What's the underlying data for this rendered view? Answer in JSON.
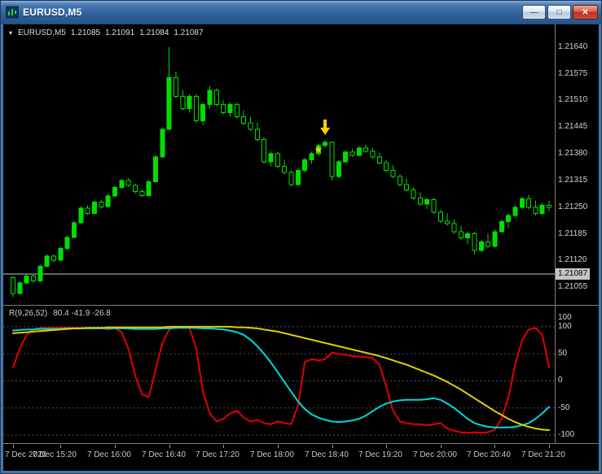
{
  "window": {
    "title": "EURUSD,M5",
    "icons": {
      "minimize": "—",
      "maximize": "□",
      "close": "✕",
      "dropdown": "▾",
      "star": "★"
    }
  },
  "colors": {
    "background": "#000000",
    "candle": "#00dd00",
    "bid_line": "#c8c8c8",
    "grid": "#4f4f4f",
    "marker": "#ffd000"
  },
  "chart_header": {
    "symbol": "EURUSD,M5",
    "open": "1.21085",
    "high": "1.21091",
    "low": "1.21084",
    "close": "1.21087"
  },
  "price_axis": {
    "labels": [
      1.2164,
      1.21575,
      1.2151,
      1.21445,
      1.2138,
      1.21315,
      1.2125,
      1.21185,
      1.2112,
      1.21055
    ],
    "current": 1.21087
  },
  "indicator": {
    "name": "R(9,26,52)",
    "values_text": "80.4 -41.9 -26.8"
  },
  "time_axis": {
    "labels": [
      {
        "t": "7 Dec 2020",
        "i": 0
      },
      {
        "t": "7 Dec 15:20",
        "i": 7
      },
      {
        "t": "7 Dec 16:00",
        "i": 15
      },
      {
        "t": "7 Dec 16:40",
        "i": 23
      },
      {
        "t": "7 Dec 17:20",
        "i": 31
      },
      {
        "t": "7 Dec 18:00",
        "i": 39
      },
      {
        "t": "7 Dec 18:40",
        "i": 47
      },
      {
        "t": "7 Dec 19:20",
        "i": 55
      },
      {
        "t": "7 Dec 20:00",
        "i": 63
      },
      {
        "t": "7 Dec 20:40",
        "i": 71
      },
      {
        "t": "7 Dec 21:20",
        "i": 79
      }
    ]
  },
  "chart_data": [
    {
      "type": "candlestick",
      "title": "EURUSD M5",
      "symbol": "EURUSD",
      "period": "M5",
      "ylim": [
        1.21012,
        1.21695
      ],
      "bid": 1.21087,
      "candles": [
        {
          "t": "14:45",
          "o": 1.21078,
          "h": 1.21082,
          "l": 1.21032,
          "c": 1.2104
        },
        {
          "t": "14:50",
          "o": 1.2104,
          "h": 1.21069,
          "l": 1.21038,
          "c": 1.21065
        },
        {
          "t": "14:55",
          "o": 1.21065,
          "h": 1.21086,
          "l": 1.21062,
          "c": 1.21082
        },
        {
          "t": "15:00",
          "o": 1.21082,
          "h": 1.21088,
          "l": 1.21066,
          "c": 1.2107
        },
        {
          "t": "15:05",
          "o": 1.2107,
          "h": 1.2111,
          "l": 1.21068,
          "c": 1.21106
        },
        {
          "t": "15:10",
          "o": 1.21106,
          "h": 1.21136,
          "l": 1.21103,
          "c": 1.21131
        },
        {
          "t": "15:15",
          "o": 1.21131,
          "h": 1.21135,
          "l": 1.21116,
          "c": 1.21121
        },
        {
          "t": "15:20",
          "o": 1.21121,
          "h": 1.21154,
          "l": 1.21119,
          "c": 1.2115
        },
        {
          "t": "15:25",
          "o": 1.2115,
          "h": 1.2118,
          "l": 1.21147,
          "c": 1.21176
        },
        {
          "t": "15:30",
          "o": 1.21176,
          "h": 1.21216,
          "l": 1.21174,
          "c": 1.21212
        },
        {
          "t": "15:35",
          "o": 1.21212,
          "h": 1.21252,
          "l": 1.2121,
          "c": 1.21248
        },
        {
          "t": "15:40",
          "o": 1.21248,
          "h": 1.21255,
          "l": 1.21231,
          "c": 1.21235
        },
        {
          "t": "15:45",
          "o": 1.21235,
          "h": 1.21266,
          "l": 1.21233,
          "c": 1.21262
        },
        {
          "t": "15:50",
          "o": 1.21262,
          "h": 1.21268,
          "l": 1.21247,
          "c": 1.21251
        },
        {
          "t": "15:55",
          "o": 1.21251,
          "h": 1.21281,
          "l": 1.21249,
          "c": 1.21277
        },
        {
          "t": "16:00",
          "o": 1.21277,
          "h": 1.21302,
          "l": 1.21274,
          "c": 1.21298
        },
        {
          "t": "16:05",
          "o": 1.21298,
          "h": 1.21319,
          "l": 1.21295,
          "c": 1.21315
        },
        {
          "t": "16:10",
          "o": 1.21315,
          "h": 1.2132,
          "l": 1.21299,
          "c": 1.21303
        },
        {
          "t": "16:15",
          "o": 1.21303,
          "h": 1.21307,
          "l": 1.21283,
          "c": 1.21288
        },
        {
          "t": "16:20",
          "o": 1.21288,
          "h": 1.21293,
          "l": 1.21274,
          "c": 1.21278
        },
        {
          "t": "16:25",
          "o": 1.21278,
          "h": 1.21316,
          "l": 1.21276,
          "c": 1.21312
        },
        {
          "t": "16:30",
          "o": 1.21312,
          "h": 1.21376,
          "l": 1.2131,
          "c": 1.21372
        },
        {
          "t": "16:35",
          "o": 1.21372,
          "h": 1.21445,
          "l": 1.2137,
          "c": 1.2144
        },
        {
          "t": "16:40",
          "o": 1.2144,
          "h": 1.2164,
          "l": 1.21438,
          "c": 1.21565
        },
        {
          "t": "16:45",
          "o": 1.21565,
          "h": 1.2158,
          "l": 1.21515,
          "c": 1.2152
        },
        {
          "t": "16:50",
          "o": 1.2152,
          "h": 1.21535,
          "l": 1.21485,
          "c": 1.2149
        },
        {
          "t": "16:55",
          "o": 1.2149,
          "h": 1.21525,
          "l": 1.2148,
          "c": 1.2152
        },
        {
          "t": "17:00",
          "o": 1.2152,
          "h": 1.21525,
          "l": 1.21455,
          "c": 1.2146
        },
        {
          "t": "17:05",
          "o": 1.2146,
          "h": 1.21505,
          "l": 1.2145,
          "c": 1.215
        },
        {
          "t": "17:10",
          "o": 1.215,
          "h": 1.21545,
          "l": 1.2149,
          "c": 1.21535
        },
        {
          "t": "17:15",
          "o": 1.21535,
          "h": 1.2154,
          "l": 1.21495,
          "c": 1.215
        },
        {
          "t": "17:20",
          "o": 1.215,
          "h": 1.2151,
          "l": 1.21475,
          "c": 1.2148
        },
        {
          "t": "17:25",
          "o": 1.2148,
          "h": 1.21505,
          "l": 1.2147,
          "c": 1.215
        },
        {
          "t": "17:30",
          "o": 1.215,
          "h": 1.21505,
          "l": 1.21465,
          "c": 1.2147
        },
        {
          "t": "17:35",
          "o": 1.2147,
          "h": 1.21485,
          "l": 1.2145,
          "c": 1.21455
        },
        {
          "t": "17:40",
          "o": 1.21455,
          "h": 1.2147,
          "l": 1.21435,
          "c": 1.2144
        },
        {
          "t": "17:45",
          "o": 1.2144,
          "h": 1.21455,
          "l": 1.2141,
          "c": 1.21415
        },
        {
          "t": "17:50",
          "o": 1.21415,
          "h": 1.2142,
          "l": 1.21355,
          "c": 1.2136
        },
        {
          "t": "17:55",
          "o": 1.2136,
          "h": 1.21385,
          "l": 1.2135,
          "c": 1.2138
        },
        {
          "t": "18:00",
          "o": 1.2138,
          "h": 1.21385,
          "l": 1.21345,
          "c": 1.2135
        },
        {
          "t": "18:05",
          "o": 1.2135,
          "h": 1.21365,
          "l": 1.2133,
          "c": 1.21335
        },
        {
          "t": "18:10",
          "o": 1.21335,
          "h": 1.2134,
          "l": 1.213,
          "c": 1.21305
        },
        {
          "t": "18:15",
          "o": 1.21305,
          "h": 1.21345,
          "l": 1.21303,
          "c": 1.2134
        },
        {
          "t": "18:20",
          "o": 1.2134,
          "h": 1.2137,
          "l": 1.21335,
          "c": 1.21365
        },
        {
          "t": "18:25",
          "o": 1.21365,
          "h": 1.21385,
          "l": 1.21355,
          "c": 1.2138
        },
        {
          "t": "18:30",
          "o": 1.2138,
          "h": 1.21405,
          "l": 1.21375,
          "c": 1.214
        },
        {
          "t": "18:35",
          "o": 1.214,
          "h": 1.21413,
          "l": 1.21395,
          "c": 1.21408
        },
        {
          "t": "18:40",
          "o": 1.21408,
          "h": 1.2141,
          "l": 1.21315,
          "c": 1.21325
        },
        {
          "t": "18:45",
          "o": 1.21325,
          "h": 1.21365,
          "l": 1.2132,
          "c": 1.2136
        },
        {
          "t": "18:50",
          "o": 1.2136,
          "h": 1.21388,
          "l": 1.21358,
          "c": 1.21384
        },
        {
          "t": "18:55",
          "o": 1.21384,
          "h": 1.21392,
          "l": 1.21372,
          "c": 1.21376
        },
        {
          "t": "19:00",
          "o": 1.21376,
          "h": 1.21398,
          "l": 1.21374,
          "c": 1.21394
        },
        {
          "t": "19:05",
          "o": 1.21394,
          "h": 1.21402,
          "l": 1.21382,
          "c": 1.21386
        },
        {
          "t": "19:10",
          "o": 1.21386,
          "h": 1.21394,
          "l": 1.21368,
          "c": 1.21372
        },
        {
          "t": "19:15",
          "o": 1.21372,
          "h": 1.21382,
          "l": 1.21354,
          "c": 1.21358
        },
        {
          "t": "19:20",
          "o": 1.21358,
          "h": 1.21364,
          "l": 1.21335,
          "c": 1.2134
        },
        {
          "t": "19:25",
          "o": 1.2134,
          "h": 1.21352,
          "l": 1.2132,
          "c": 1.21325
        },
        {
          "t": "19:30",
          "o": 1.21325,
          "h": 1.2133,
          "l": 1.213,
          "c": 1.21305
        },
        {
          "t": "19:35",
          "o": 1.21305,
          "h": 1.2132,
          "l": 1.21288,
          "c": 1.21292
        },
        {
          "t": "19:40",
          "o": 1.21292,
          "h": 1.21298,
          "l": 1.21268,
          "c": 1.21272
        },
        {
          "t": "19:45",
          "o": 1.21272,
          "h": 1.21286,
          "l": 1.21254,
          "c": 1.21258
        },
        {
          "t": "19:50",
          "o": 1.21258,
          "h": 1.21272,
          "l": 1.21246,
          "c": 1.21268
        },
        {
          "t": "19:55",
          "o": 1.21268,
          "h": 1.21272,
          "l": 1.21234,
          "c": 1.21238
        },
        {
          "t": "20:00",
          "o": 1.21238,
          "h": 1.21244,
          "l": 1.21212,
          "c": 1.21216
        },
        {
          "t": "20:05",
          "o": 1.21216,
          "h": 1.21235,
          "l": 1.21205,
          "c": 1.2121
        },
        {
          "t": "20:10",
          "o": 1.2121,
          "h": 1.2122,
          "l": 1.21185,
          "c": 1.2119
        },
        {
          "t": "20:15",
          "o": 1.2119,
          "h": 1.21205,
          "l": 1.2117,
          "c": 1.21175
        },
        {
          "t": "20:20",
          "o": 1.21175,
          "h": 1.2119,
          "l": 1.2116,
          "c": 1.21185
        },
        {
          "t": "20:25",
          "o": 1.21185,
          "h": 1.2119,
          "l": 1.21135,
          "c": 1.21145
        },
        {
          "t": "20:30",
          "o": 1.21145,
          "h": 1.2117,
          "l": 1.2114,
          "c": 1.21165
        },
        {
          "t": "20:35",
          "o": 1.21165,
          "h": 1.21185,
          "l": 1.2115,
          "c": 1.21155
        },
        {
          "t": "20:40",
          "o": 1.21155,
          "h": 1.21195,
          "l": 1.21152,
          "c": 1.2119
        },
        {
          "t": "20:45",
          "o": 1.2119,
          "h": 1.2122,
          "l": 1.21188,
          "c": 1.21215
        },
        {
          "t": "20:50",
          "o": 1.21215,
          "h": 1.21235,
          "l": 1.212,
          "c": 1.2123
        },
        {
          "t": "20:55",
          "o": 1.2123,
          "h": 1.21255,
          "l": 1.21225,
          "c": 1.2125
        },
        {
          "t": "21:00",
          "o": 1.2125,
          "h": 1.21275,
          "l": 1.21245,
          "c": 1.2127
        },
        {
          "t": "21:05",
          "o": 1.2127,
          "h": 1.2128,
          "l": 1.21245,
          "c": 1.2125
        },
        {
          "t": "21:10",
          "o": 1.2125,
          "h": 1.21265,
          "l": 1.2123,
          "c": 1.21235
        },
        {
          "t": "21:15",
          "o": 1.21235,
          "h": 1.2126,
          "l": 1.21232,
          "c": 1.21255
        },
        {
          "t": "21:20",
          "o": 1.21255,
          "h": 1.21265,
          "l": 1.2124,
          "c": 1.2125
        }
      ],
      "annotations": [
        {
          "type": "arrow-down",
          "index": 46,
          "price": 1.2142,
          "color": "#ffd000"
        },
        {
          "type": "star",
          "index": 45,
          "price": 1.2139,
          "color": "#ffd000"
        }
      ]
    },
    {
      "type": "line",
      "title": "R(9,26,52)",
      "ylim": [
        -115,
        139
      ],
      "levels": [
        100,
        50,
        0,
        -50,
        -100
      ],
      "axis_labels": [
        {
          "t": "100",
          "v": 117
        },
        {
          "t": "100",
          "v": 100
        },
        {
          "t": "50",
          "v": 50
        },
        {
          "t": "0",
          "v": 0
        },
        {
          "t": "-50",
          "v": -50
        },
        {
          "t": "-100",
          "v": -100
        }
      ],
      "last_values": [
        80.4,
        -41.9,
        -26.8
      ],
      "series": [
        {
          "name": "fast",
          "color": "#e10000",
          "values": [
            25,
            60,
            85,
            95,
            98,
            98,
            98,
            98,
            98,
            98,
            98,
            98,
            98,
            98,
            95,
            98,
            90,
            60,
            10,
            -25,
            -30,
            20,
            70,
            95,
            100,
            100,
            98,
            60,
            -20,
            -60,
            -75,
            -70,
            -60,
            -55,
            -68,
            -75,
            -72,
            -78,
            -80,
            -75,
            -78,
            -80,
            -45,
            35,
            40,
            38,
            40,
            52,
            50,
            48,
            46,
            45,
            44,
            42,
            30,
            -10,
            -55,
            -75,
            -78,
            -80,
            -80,
            -82,
            -80,
            -78,
            -88,
            -92,
            -95,
            -96,
            -95,
            -96,
            -95,
            -90,
            -70,
            -30,
            30,
            75,
            95,
            98,
            85,
            25
          ]
        },
        {
          "name": "mid",
          "color": "#00d8d8",
          "values": [
            93,
            94,
            95,
            95,
            96,
            96,
            96,
            96,
            97,
            97,
            97,
            97,
            97,
            97,
            97,
            97,
            97,
            97,
            96,
            96,
            96,
            96,
            97,
            97,
            98,
            98,
            98,
            98,
            97,
            97,
            96,
            95,
            93,
            90,
            85,
            76,
            64,
            50,
            34,
            16,
            -2,
            -20,
            -38,
            -52,
            -62,
            -68,
            -72,
            -75,
            -76,
            -75,
            -73,
            -70,
            -64,
            -56,
            -48,
            -42,
            -38,
            -36,
            -35,
            -35,
            -35,
            -34,
            -32,
            -35,
            -42,
            -50,
            -60,
            -70,
            -78,
            -82,
            -85,
            -86,
            -86,
            -86,
            -85,
            -82,
            -78,
            -70,
            -60,
            -48
          ]
        },
        {
          "name": "slow",
          "color": "#e0cd00",
          "values": [
            88,
            89,
            90,
            91,
            92,
            93,
            94,
            95,
            96,
            97,
            97,
            98,
            98,
            98,
            99,
            99,
            99,
            99,
            99,
            99,
            99,
            99,
            99,
            100,
            100,
            100,
            100,
            100,
            100,
            100,
            100,
            100,
            100,
            99,
            99,
            98,
            97,
            95,
            93,
            91,
            88,
            85,
            82,
            79,
            76,
            73,
            70,
            67,
            64,
            61,
            58,
            55,
            52,
            49,
            46,
            42,
            38,
            34,
            30,
            25,
            20,
            15,
            10,
            4,
            -2,
            -9,
            -16,
            -24,
            -32,
            -40,
            -48,
            -56,
            -63,
            -70,
            -76,
            -81,
            -85,
            -88,
            -90,
            -91
          ]
        }
      ]
    }
  ]
}
